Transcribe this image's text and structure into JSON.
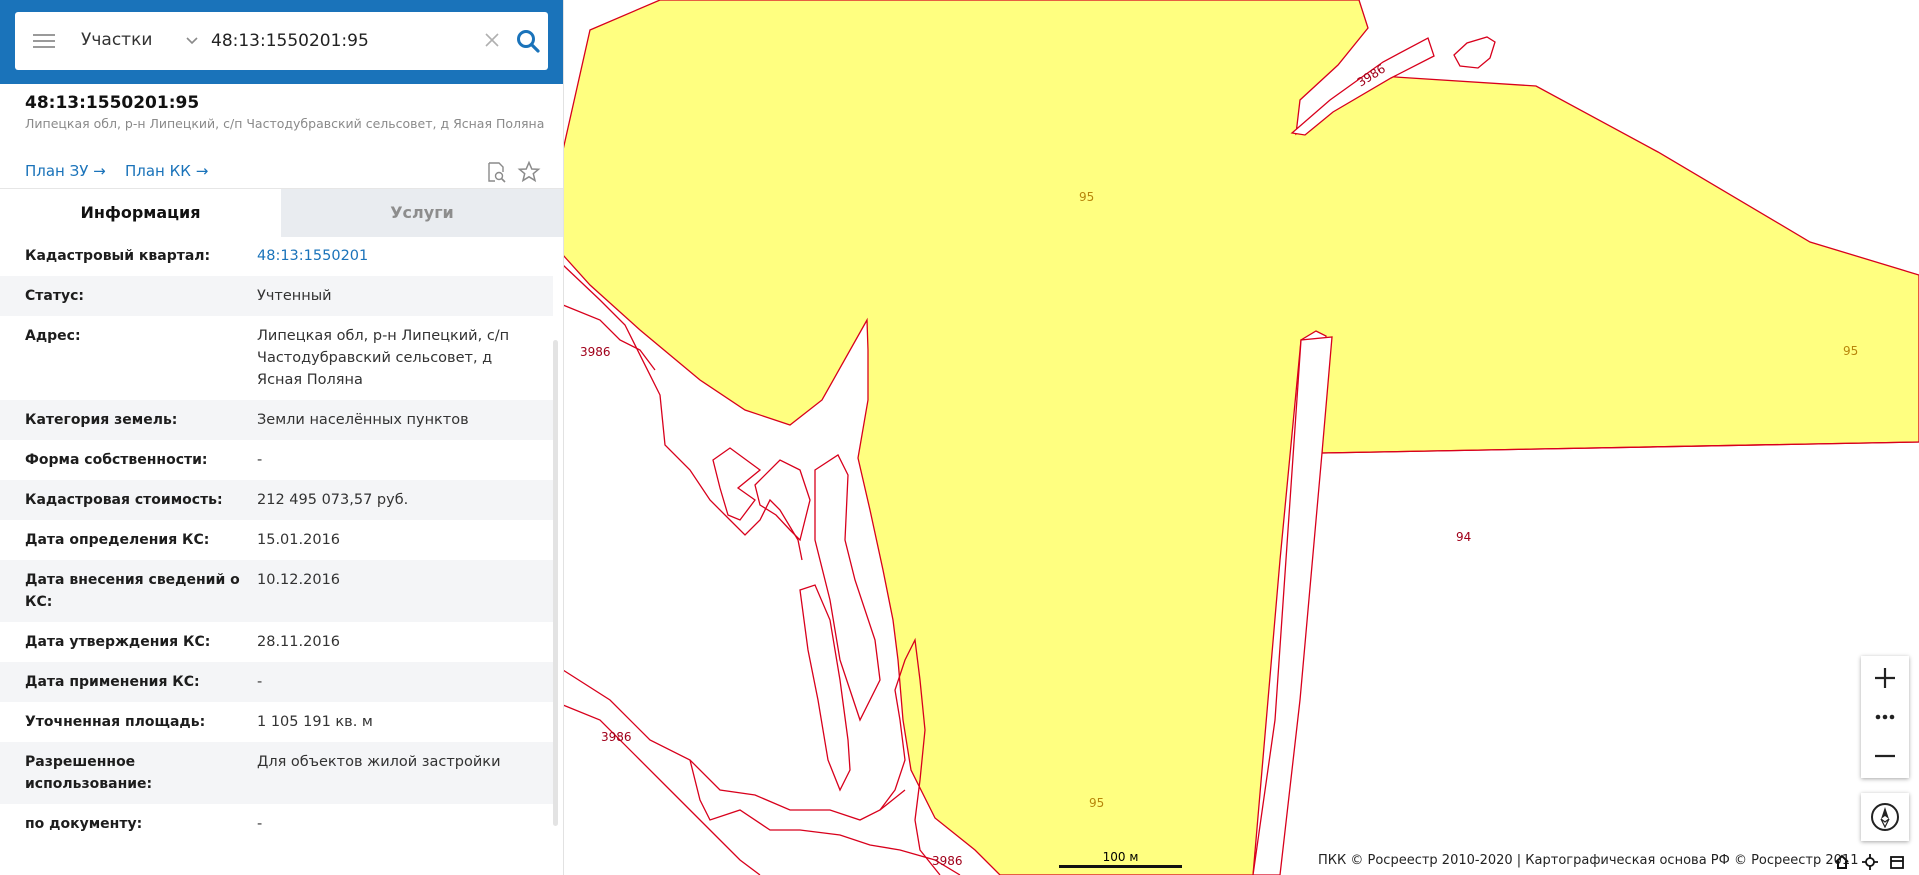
{
  "search": {
    "layer_label": "Участки",
    "query": "48:13:1550201:95",
    "placeholder": ""
  },
  "object": {
    "cadastral_number": "48:13:1550201:95",
    "address_short": "Липецкая обл, р-н Липецкий, с/п Частодубравский сельсовет, д Ясная Поляна",
    "plan_zu": "План ЗУ →",
    "plan_kk": "План КК →"
  },
  "tabs": {
    "info": "Информация",
    "services": "Услуги"
  },
  "info_rows": [
    {
      "label": "Кадастровый квартал:",
      "value": "48:13:1550201",
      "link": true
    },
    {
      "label": "Статус:",
      "value": "Учтенный"
    },
    {
      "label": "Адрес:",
      "value": "Липецкая обл, р-н Липецкий, с/п Частодубравский сельсовет, д Ясная Поляна"
    },
    {
      "label": "Категория земель:",
      "value": "Земли населённых пунктов"
    },
    {
      "label": "Форма собственности:",
      "value": "-"
    },
    {
      "label": "Кадастровая стоимость:",
      "value": "212 495 073,57 руб."
    },
    {
      "label": "Дата определения КС:",
      "value": "15.01.2016"
    },
    {
      "label": "Дата внесения сведений о КС:",
      "value": "10.12.2016"
    },
    {
      "label": "Дата утверждения КС:",
      "value": "28.11.2016"
    },
    {
      "label": "Дата применения КС:",
      "value": "-"
    },
    {
      "label": "Уточненная площадь:",
      "value": "1 105 191 кв. м"
    },
    {
      "label": "Разрешенное использование:",
      "value": "Для объектов жилой застройки"
    },
    {
      "label": "по документу:",
      "value": "-"
    }
  ],
  "map": {
    "labels": {
      "p95_top": "95",
      "p95_right": "95",
      "p95_bottom": "95",
      "p94": "94",
      "p3986_a": "3986",
      "p3986_b": "3986",
      "p3986_c": "3986",
      "p3986_d": "3986"
    },
    "scale_label": "100 м",
    "copyright": "ПКК © Росреестр 2010-2020 | Картографическая основа РФ © Росреестр 2011",
    "colors": {
      "parcel_fill": "#ffff80",
      "boundary": "#d8001c",
      "label_yellow": "#b8860b",
      "label_red": "#a0001a",
      "accent": "#1a73ba"
    }
  },
  "icons": {
    "menu": "hamburger-icon",
    "dropdown": "chevron-down-icon",
    "clear": "close-icon",
    "search": "search-icon",
    "collapse": "chevron-left-icon",
    "print_preview": "document-search-icon",
    "favorite": "star-icon",
    "zoom_in": "plus-icon",
    "more": "ellipsis-icon",
    "zoom_out": "minus-icon",
    "compass": "compass-icon",
    "home": "home-icon",
    "locate": "crosshair-icon",
    "layers": "layers-icon"
  }
}
